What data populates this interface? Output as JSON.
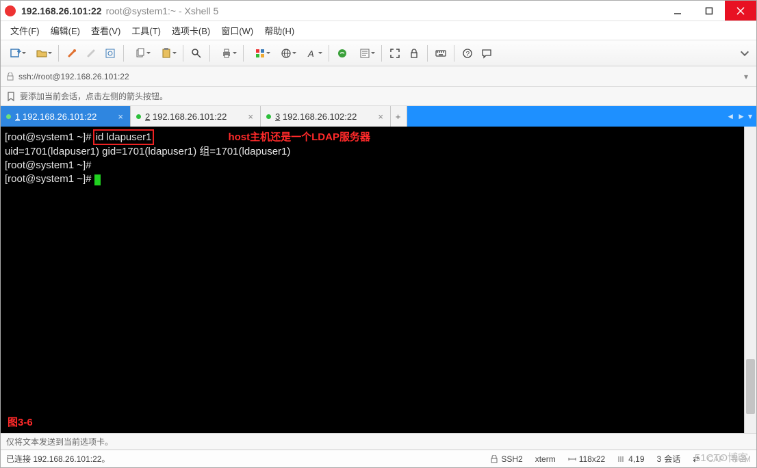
{
  "title": {
    "ip": "192.168.26.101:22",
    "rest": "root@system1:~ - Xshell 5"
  },
  "menu": {
    "file": "文件(F)",
    "edit": "编辑(E)",
    "view": "查看(V)",
    "tools": "工具(T)",
    "card": "选项卡(B)",
    "window": "窗口(W)",
    "help": "帮助(H)"
  },
  "addr": {
    "url": "ssh://root@192.168.26.101:22"
  },
  "hint": {
    "text": "要添加当前会话，点击左侧的箭头按钮。"
  },
  "tabs": {
    "t1": {
      "num": "1",
      "label": "192.168.26.101:22"
    },
    "t2": {
      "num": "2",
      "label": "192.168.26.101:22"
    },
    "t3": {
      "num": "3",
      "label": "192.168.26.102:22"
    },
    "add": "+"
  },
  "term": {
    "p1a": "[root@system1 ~]# ",
    "cmd": "id ldapuser1",
    "annot": "host主机还是一个LDAP服务器",
    "l2": "uid=1701(ldapuser1) gid=1701(ldapuser1) 组=1701(ldapuser1)",
    "l3": "[root@system1 ~]#",
    "l4": "[root@system1 ~]# ",
    "fig": "图3-6"
  },
  "info": {
    "text": "仅将文本发送到当前选项卡。"
  },
  "status": {
    "conn": "已连接 192.168.26.101:22。",
    "ssh": "SSH2",
    "term": "xterm",
    "size": "118x22",
    "pos": "4,19",
    "sess_n": "3",
    "sess_l": "会话",
    "caps": "CAP",
    "num": "NUM"
  },
  "watermark": "51CTO博客"
}
